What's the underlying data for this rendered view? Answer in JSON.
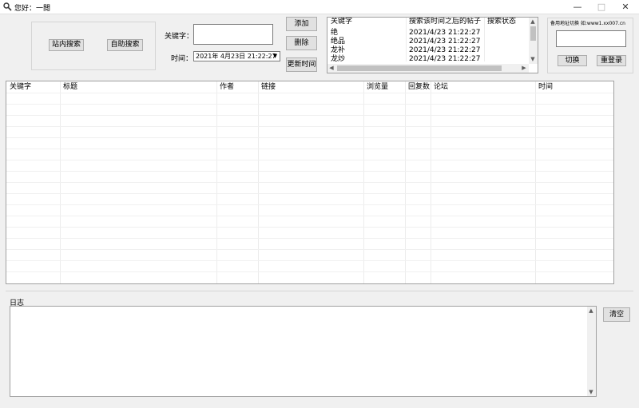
{
  "window": {
    "title": "您好：一閲"
  },
  "search_group": {
    "site_search": "站内搜索",
    "auto_search": "自助搜索"
  },
  "keyword": {
    "label": "关键字：",
    "value": ""
  },
  "time": {
    "label": "时间：",
    "value": "2021年 4月23日 21:22:27"
  },
  "actions": {
    "add": "添加",
    "delete": "删除",
    "update_time": "更新时间"
  },
  "keyword_table": {
    "headers": [
      "关键字",
      "搜索该时间之后的帖子",
      "搜索状态"
    ],
    "rows": [
      {
        "keyword": "绝",
        "time": "2021/4/23 21:22:27",
        "status": ""
      },
      {
        "keyword": "绝品",
        "time": "2021/4/23 21:22:27",
        "status": ""
      },
      {
        "keyword": "龙补",
        "time": "2021/4/23 21:22:27",
        "status": ""
      },
      {
        "keyword": "龙炒",
        "time": "2021/4/23 21:22:27",
        "status": ""
      }
    ]
  },
  "backup": {
    "label": "备用地址切换 如:www1.xx007.cn",
    "value": "",
    "switch": "切换",
    "relogin": "重登录"
  },
  "results_table": {
    "headers": [
      "关键字",
      "标题",
      "作者",
      "链接",
      "浏览量",
      "回复数",
      "论坛",
      "时间"
    ]
  },
  "log": {
    "label": "日志",
    "clear": "清空"
  }
}
